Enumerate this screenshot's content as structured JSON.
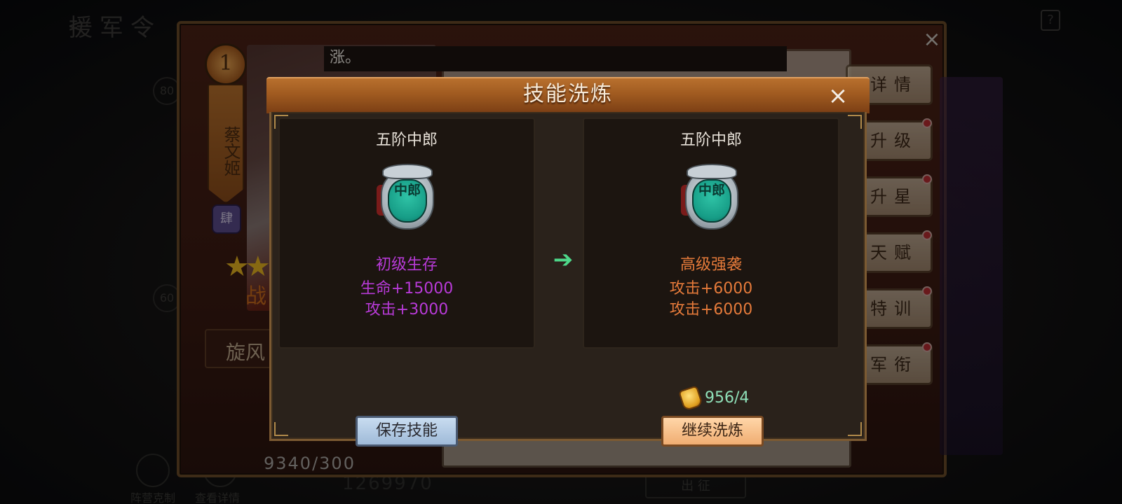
{
  "background": {
    "page_title": "援军令",
    "back_icon": "back-arrow-icon",
    "help_label": "?",
    "left_badges": [
      "80",
      "60"
    ],
    "bottom_left": {
      "item1_label": "阵营克制",
      "item2_label": "查看详情"
    },
    "bottom_number": "1269970",
    "bottom_button": "出 征"
  },
  "hero": {
    "level": "1",
    "name": "蔡文姬",
    "rank": "肆",
    "star_text": "★★",
    "power_label": "战",
    "skill_slot_label": "旋风",
    "exp": "9340/300",
    "caption": "涨。",
    "close_label": "×",
    "tabs": [
      {
        "label": "详情",
        "dot": false
      },
      {
        "label": "升级",
        "dot": true
      },
      {
        "label": "升星",
        "dot": true
      },
      {
        "label": "天赋",
        "dot": true
      },
      {
        "label": "特训",
        "dot": true
      },
      {
        "label": "军衔",
        "dot": true
      }
    ]
  },
  "modal": {
    "title": "技能洗炼",
    "close_label": "×",
    "current": {
      "rank_title": "五阶中郎",
      "medal_text": "中郎",
      "skill_name": "初级生存",
      "stats": [
        "生命+15000",
        "攻击+3000"
      ]
    },
    "arrow": "➔",
    "new": {
      "rank_title": "五阶中郎",
      "medal_text": "中郎",
      "skill_name": "高级强袭",
      "stats": [
        "攻击+6000",
        "攻击+6000"
      ]
    },
    "cost": "956/4",
    "save_button": "保存技能",
    "continue_button": "继续洗炼"
  }
}
